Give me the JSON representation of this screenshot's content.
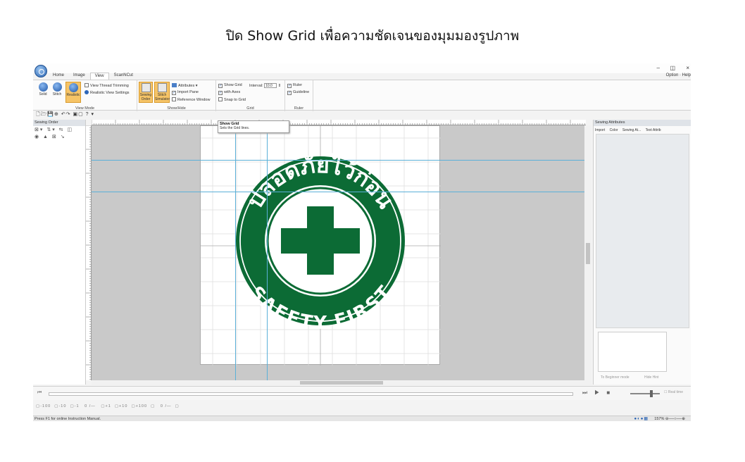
{
  "heading": "ปิด Show Grid  เพื่อความชัดเจนของมุมมองรูปภาพ",
  "window": {
    "minimize": "–",
    "maximize": "◫",
    "close": "×"
  },
  "tabs": [
    "Home",
    "Image",
    "View",
    "ScanNCut"
  ],
  "options_menu": "Option  ·  Help",
  "ribbon": {
    "view_mode": {
      "label": "View Mode",
      "solid": "Solid",
      "stitch": "Stitch",
      "realistic": "Realistic",
      "view_thread_trimming": "View Thread Trimming",
      "realistic_view_settings": "Realistic View Settings"
    },
    "show_hide": {
      "label": "Show/Hide",
      "sewing_order": "Sewing Order",
      "stitch_simulator": "Stitch Simulator",
      "attributes": "Attributes",
      "import_pane": "Import Pane",
      "reference_window": "Reference Window"
    },
    "grid": {
      "label": "Grid",
      "show_grid": "Show Grid",
      "interval_label": "Interval:",
      "interval_value": "10.0",
      "with_axes": "with Axes",
      "snap_to_grid": "Snap to Grid"
    },
    "ruler": {
      "label": "Ruler",
      "ruler": "Ruler",
      "guideline": "Guideline"
    }
  },
  "tooltip": {
    "title": "Show Grid",
    "description": "Sets the Grid lines."
  },
  "sewing_order_panel": {
    "title": "Sewing Order"
  },
  "sewing_attributes_panel": {
    "title": "Sewing Attributes",
    "tabs": [
      "Import",
      "Color",
      "Sewing At...",
      "Text Attrib"
    ],
    "beginner_mode": "To Beginner mode",
    "hide_hint": "Hide Hint"
  },
  "player": {
    "realtime": "Real time"
  },
  "navigation": "▢-100  ▢-10  ▢-1   0 /—   ▢+1  ▢+10  ▢+100  ▢   0 /—  ▢",
  "status_bar": {
    "text": "Press  F1  for online Instruction Manual.",
    "zoom": "157%"
  },
  "logo": {
    "thai_text": "ปลอดภัยไว้ก่อน",
    "english_text": "SAFETY FIRST",
    "color": "#0c6b35"
  }
}
